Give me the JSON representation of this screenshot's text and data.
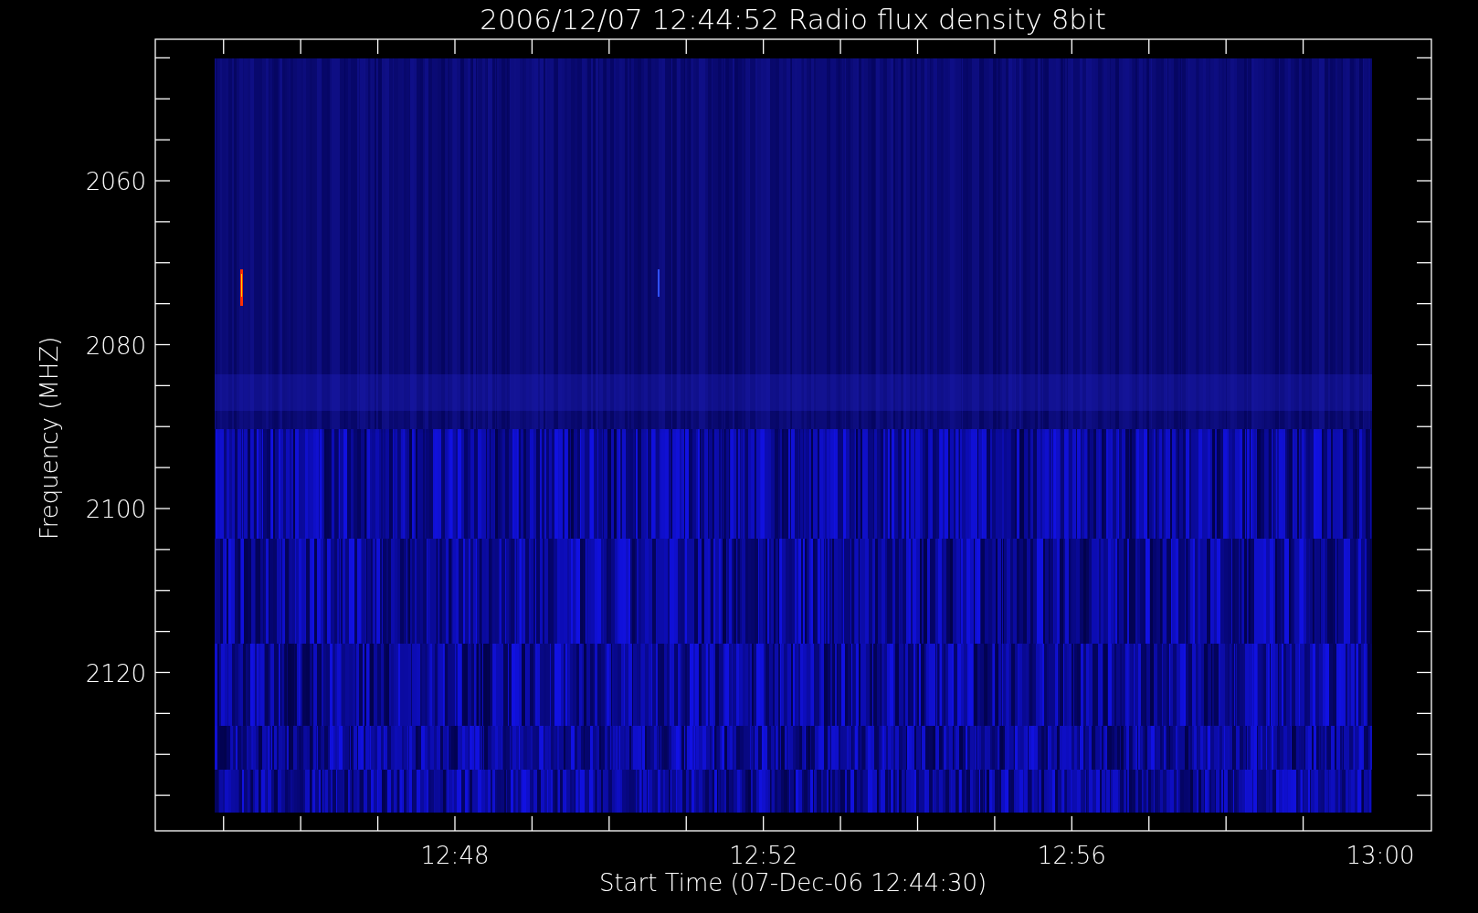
{
  "plot": {
    "title": "2006/12/07 12:44:52 Radio flux density 8bit",
    "xlabel": "Start Time (07-Dec-06 12:44:30)",
    "ylabel": "Frequency (MHZ)",
    "x_tick_labels": [
      "12:48",
      "12:52",
      "12:56",
      "13:00"
    ],
    "y_tick_labels": [
      "2060",
      "2080",
      "2100",
      "2120"
    ]
  }
}
